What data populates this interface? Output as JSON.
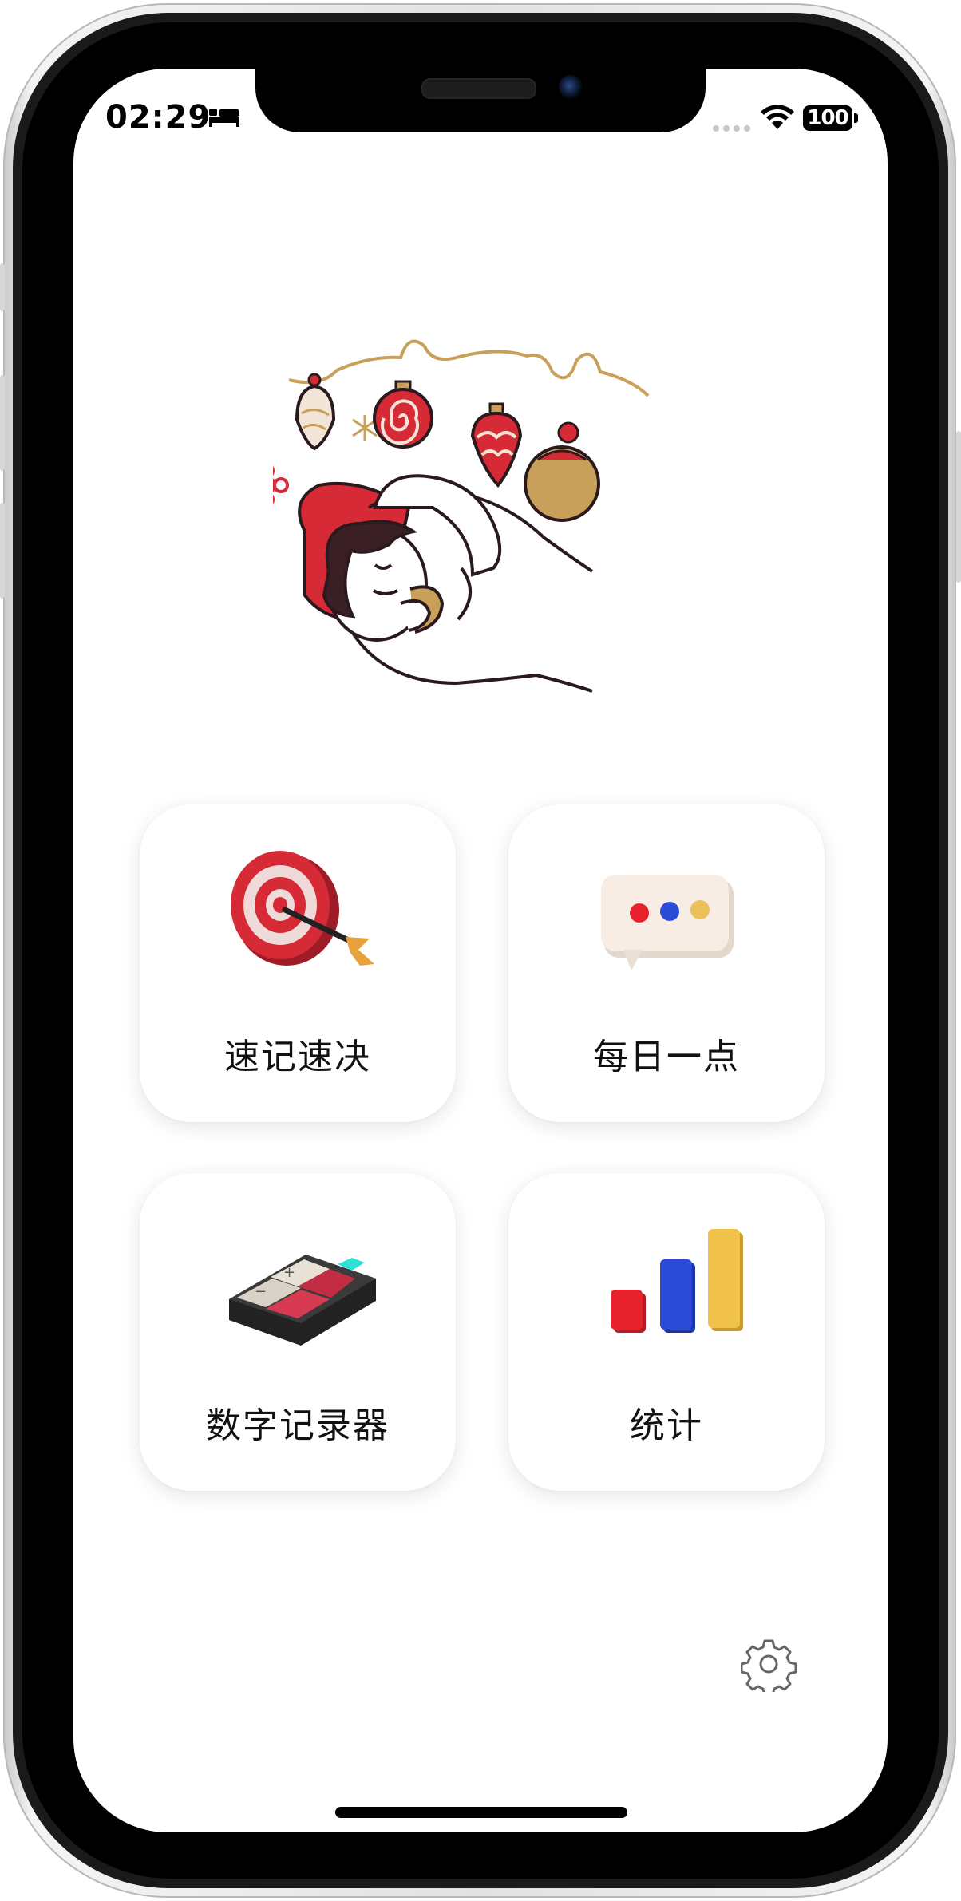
{
  "status_bar": {
    "time": "02:29",
    "battery": "100",
    "icons": [
      "bed-icon",
      "signal-dots-icon",
      "wifi-icon",
      "battery-icon"
    ]
  },
  "hero": {
    "illustration": "sleeping-person-christmas-ornaments-illustration"
  },
  "menu": {
    "items": [
      {
        "label": "速记速决",
        "icon": "dartboard-target-icon"
      },
      {
        "label": "每日一点",
        "icon": "chat-bubble-dots-icon"
      },
      {
        "label": "数字记录器",
        "icon": "calculator-icon"
      },
      {
        "label": "统计",
        "icon": "bar-chart-icon"
      }
    ]
  },
  "footer": {
    "settings_icon": "gear-icon"
  },
  "colors": {
    "red": "#d62a36",
    "blue": "#2b4bd6",
    "yellow": "#f0c24a",
    "gold": "#c9a05a",
    "outline": "#2a1a1e"
  }
}
